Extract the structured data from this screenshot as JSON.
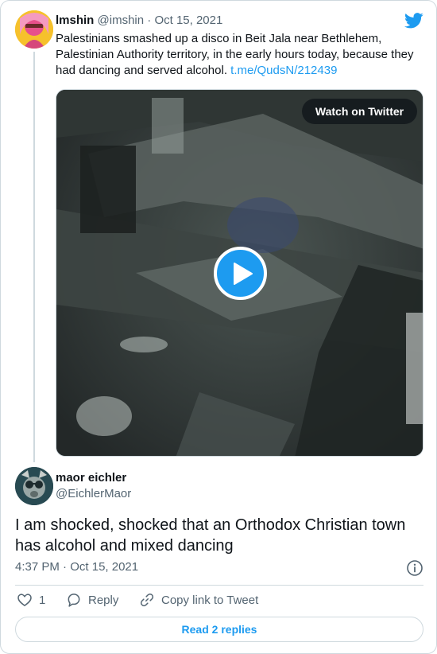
{
  "quoted_tweet": {
    "name": "lmshin",
    "handle": "@imshin",
    "dot": "·",
    "date": "Oct 15, 2021",
    "text": "Palestinians smashed up a disco in Beit Jala near Bethlehem, Palestinian Authority territory, in the early hours today, because they had dancing and served alcohol. ",
    "link": "t.me/QudsN/212439",
    "watch_label": "Watch on Twitter"
  },
  "main_tweet": {
    "name": "maor eichler",
    "handle": "@EichlerMaor",
    "text": "I am shocked, shocked that an Orthodox Christian town has alcohol and mixed dancing",
    "time": "4:37 PM",
    "dot": "·",
    "date": "Oct 15, 2021"
  },
  "actions": {
    "like_count": "1",
    "reply_label": "Reply",
    "copy_label": "Copy link to Tweet"
  },
  "read_replies_label": "Read 2 replies",
  "colors": {
    "accent": "#1d9bf0",
    "secondary_text": "#536471",
    "border": "#cfd9de"
  },
  "icons": [
    "twitter-bird-icon",
    "play-icon",
    "info-icon",
    "heart-icon",
    "reply-bubble-icon",
    "link-icon"
  ]
}
